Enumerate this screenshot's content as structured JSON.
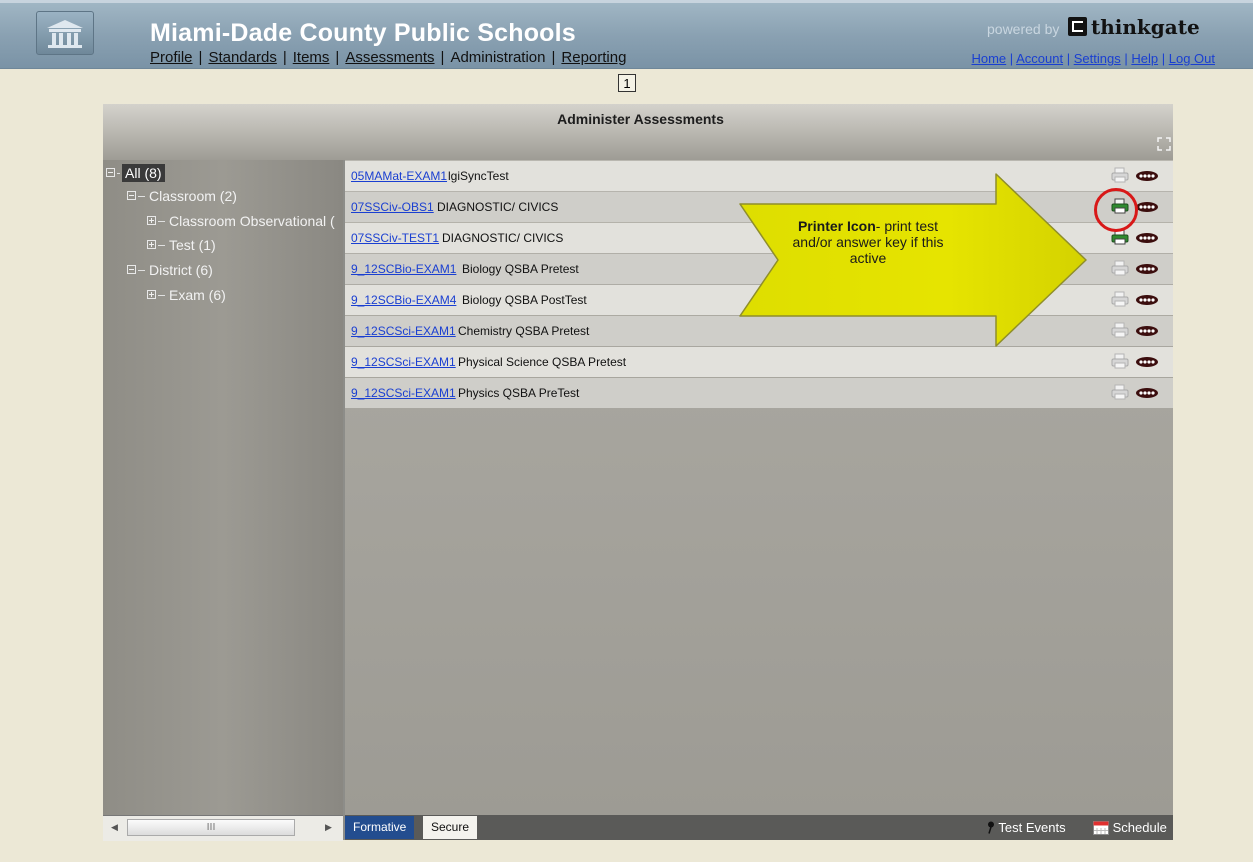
{
  "header": {
    "title": "Miami-Dade County Public Schools",
    "nav": {
      "profile": "Profile",
      "standards": "Standards",
      "items": "Items",
      "assessments": "Assessments",
      "administration": "Administration",
      "reporting": "Reporting",
      "separator": "|"
    },
    "powered_by": "powered by",
    "brand": "thinkgate",
    "util": {
      "home": "Home",
      "account": "Account",
      "settings": "Settings",
      "help": "Help",
      "logout": "Log Out",
      "separator": "|"
    }
  },
  "pager": {
    "page": "1"
  },
  "panel": {
    "title": "Administer Assessments"
  },
  "tree": [
    {
      "label": "All (8)"
    },
    {
      "label": "Classroom (2)"
    },
    {
      "label": "Classroom Observational ("
    },
    {
      "label": "Test (1)"
    },
    {
      "label": "District (6)"
    },
    {
      "label": "Exam (6)"
    }
  ],
  "assessments": [
    {
      "code": "05MAMat-EXAM1",
      "name": "lgiSyncTest",
      "printer_active": false
    },
    {
      "code": "07SSCiv-OBS1",
      "name": "DIAGNOSTIC/ CIVICS",
      "printer_active": true
    },
    {
      "code": "07SSCiv-TEST1",
      "name": "DIAGNOSTIC/ CIVICS",
      "printer_active": true
    },
    {
      "code": "9_12SCBio-EXAM1",
      "name": "Biology QSBA Pretest",
      "printer_active": false
    },
    {
      "code": "9_12SCBio-EXAM4",
      "name": "Biology QSBA PostTest",
      "printer_active": false
    },
    {
      "code": "9_12SCSci-EXAM1",
      "name": "Chemistry QSBA Pretest",
      "printer_active": false
    },
    {
      "code": "9_12SCSci-EXAM1",
      "name": "Physical Science QSBA Pretest",
      "printer_active": false
    },
    {
      "code": "9_12SCSci-EXAM1",
      "name": "Physics QSBA PreTest",
      "printer_active": false
    }
  ],
  "scrollbar": {
    "grip": "III"
  },
  "footer": {
    "tab_formative": "Formative",
    "tab_secure": "Secure",
    "test_events": "Test Events",
    "schedule": "Schedule"
  },
  "callout": {
    "bold": "Printer Icon",
    "rest": "- print test and/or answer key if this active",
    "color": "#e6e400",
    "circle_color": "#d81818"
  },
  "colors": {
    "link": "#1a3fd1",
    "header_bg": "#8aa1b2",
    "tab_active": "#234d8f"
  },
  "icons": [
    "building-logo-icon",
    "expand-icon",
    "printer-icon",
    "ellipsis-icon",
    "pin-icon",
    "calendar-icon"
  ]
}
